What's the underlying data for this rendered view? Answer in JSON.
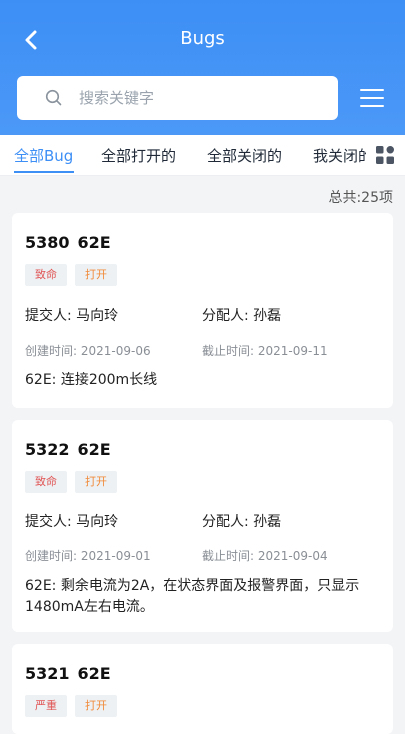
{
  "header": {
    "title": "Bugs"
  },
  "search": {
    "placeholder": "搜索关键字"
  },
  "tabs": [
    {
      "label": "全部Bug",
      "active": true
    },
    {
      "label": "全部打开的",
      "active": false
    },
    {
      "label": "全部关闭的",
      "active": false
    },
    {
      "label": "我关闭的",
      "active": false
    }
  ],
  "total": "总共:25项",
  "bugs": [
    {
      "id": "5380",
      "product": "62E",
      "severity": "致命",
      "status": "打开",
      "submitter_label": "提交人:",
      "submitter": "马向玲",
      "assignee_label": "分配人:",
      "assignee": "孙磊",
      "created_label": "创建时间:",
      "created": "2021-09-06",
      "deadline_label": "截止时间:",
      "deadline": "2021-09-11",
      "desc": "62E: 连接200m长线"
    },
    {
      "id": "5322",
      "product": "62E",
      "severity": "致命",
      "status": "打开",
      "submitter_label": "提交人:",
      "submitter": "马向玲",
      "assignee_label": "分配人:",
      "assignee": "孙磊",
      "created_label": "创建时间:",
      "created": "2021-09-01",
      "deadline_label": "截止时间:",
      "deadline": "2021-09-04",
      "desc": "62E: 剩余电流为2A，在状态界面及报警界面，只显示1480mA左右电流。"
    },
    {
      "id": "5321",
      "product": "62E",
      "severity": "严重",
      "status": "打开"
    }
  ],
  "colors": {
    "primary": "#3d8ff6",
    "severity": "#e05555",
    "status": "#f08a3a"
  },
  "icons": {
    "back": "chevron-left-icon",
    "search": "search-icon",
    "menu": "hamburger-menu-icon",
    "grid": "grid-view-icon"
  }
}
